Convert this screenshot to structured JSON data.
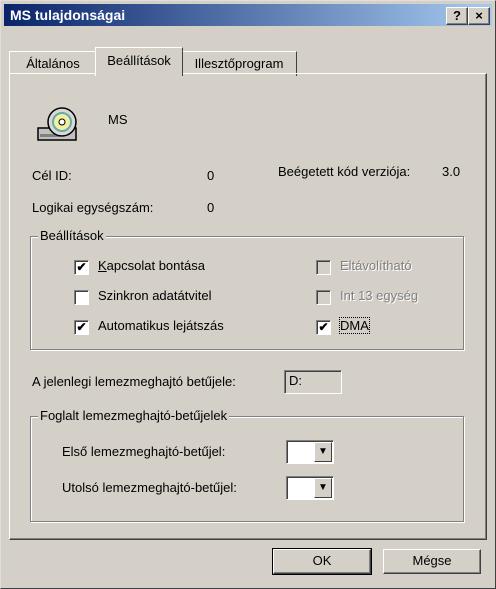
{
  "window": {
    "title": "MS tulajdonságai",
    "help_label": "?",
    "close_label": "×"
  },
  "tabs": [
    {
      "label": "Általános"
    },
    {
      "label": "Beállítások"
    },
    {
      "label": "Illesztőprogram"
    }
  ],
  "device": {
    "name": "MS",
    "icon": "cd-drive-icon"
  },
  "info": {
    "target_id_label": "Cél ID:",
    "target_id_value": "0",
    "firmware_label": "Beégetett kód verziója:",
    "firmware_value": "3.0",
    "lun_label": "Logikai egységszám:",
    "lun_value": "0"
  },
  "settings": {
    "title": "Beállítások",
    "disconnect": {
      "label": "Kapcsolat bontása",
      "checked": true
    },
    "sync": {
      "label": "Szinkron adatátvitel",
      "checked": false
    },
    "autoplay": {
      "label": "Automatikus lejátszás",
      "checked": true
    },
    "removable": {
      "label": "Eltávolítható",
      "checked": false
    },
    "int13": {
      "label": "Int 13 egység",
      "checked": false
    },
    "dma": {
      "label": "DMA",
      "checked": true
    }
  },
  "current_letter": {
    "label": "A jelenlegi lemezmeghajtó betűjele:",
    "value": "D:"
  },
  "reserved": {
    "title": "Foglalt lemezmeghajtó-betűjelek",
    "first_label": "Első lemezmeghajtó-betűjel:",
    "last_label": "Utolsó lemezmeghajtó-betűjel:"
  },
  "buttons": {
    "ok": "OK",
    "cancel": "Mégse"
  },
  "check_mark": "✔",
  "dropdown_arrow": "▼"
}
